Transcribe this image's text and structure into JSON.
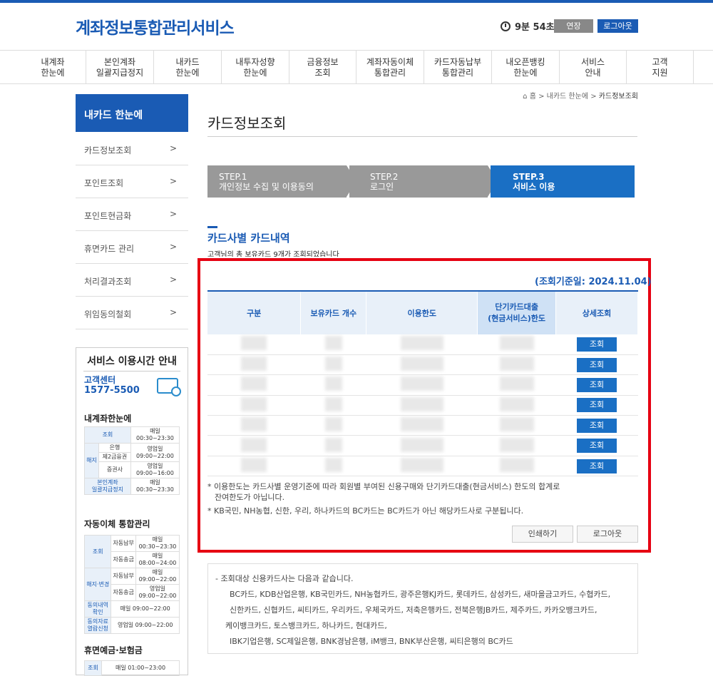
{
  "header": {
    "logo": "계좌정보통합관리서비스",
    "timer": "9분 54초",
    "extend_label": "연장",
    "logout_label": "로그아웃"
  },
  "gnb": [
    "내계좌\n한눈에",
    "본인계좌\n일괄지급정지",
    "내카드\n한눈에",
    "내투자성향\n한눈에",
    "금융정보\n조회",
    "계좌자동이체\n통합관리",
    "카드자동납부\n통합관리",
    "내오픈뱅킹\n한눈에",
    "서비스\n안내",
    "고객\n지원"
  ],
  "breadcrumb": [
    "홈",
    "내카드 한눈에",
    "카드정보조회"
  ],
  "sidebar": {
    "title": "내카드 한눈에",
    "items": [
      "카드정보조회",
      "포인트조회",
      "포인트현금화",
      "휴면카드 관리",
      "처리결과조회",
      "위임동의철회"
    ]
  },
  "timebox": {
    "title": "서비스 이용시간 안내",
    "cc_label": "고객센터",
    "cc_number": "1577-5500",
    "sec1": "내계좌한눈에",
    "sec2": "자동이체 통합관리",
    "sec3": "휴면예금·보험금",
    "t1": {
      "r1k": "조회",
      "r1v": "매일\n00:30~23:30",
      "g": "해지",
      "r2k": "은행",
      "r2v": "영업일\n09:00~22:00",
      "r3k": "제2금융권",
      "r4k": "증권사",
      "r4v": "영업일\n09:00~16:00",
      "r5k": "본인계좌\n일괄지급정지",
      "r5v": "매일\n00:30~23:30"
    },
    "t2": {
      "g1": "조회",
      "a": "자동납부",
      "av": "매일\n00:30~23:30",
      "b": "자동송금",
      "bv": "매일\n08:00~24:00",
      "g2": "해지·변경",
      "c": "자동납부",
      "cv": "매일\n09:00~22:00",
      "d": "자동송금",
      "dv": "영업일\n09:00~22:00",
      "e": "동의내역\n확인",
      "ev": "매일 09:00~22:00",
      "f": "동의자료\n열람신청",
      "fv": "영업일 09:00~22:00"
    },
    "t3": {
      "k": "조회",
      "v": "매일 01:00~23:00"
    }
  },
  "main": {
    "title": "카드정보조회",
    "steps": [
      {
        "num": "STEP.1",
        "label": "개인정보 수집 및 이용동의"
      },
      {
        "num": "STEP.2",
        "label": "로그인"
      },
      {
        "num": "STEP.3",
        "label": "서비스 이용"
      }
    ],
    "section_title": "카드사별 카드내역",
    "summary": "고객님의 총 보유카드 9개가 조회되었습니다",
    "as_of": "(조회기준일: 2024.11.04)",
    "table": {
      "headers": [
        "구분",
        "보유카드 개수",
        "이용한도",
        "단기카드대출\n(현금서비스)한도",
        "상세조회"
      ],
      "row_button": "조회",
      "rows": 7
    },
    "notes": [
      "* 이용한도는 카드사별 운영기준에 따라 회원별 부여된 신용구매와 단기카드대출(현금서비스) 한도의 합계로",
      "잔여한도가 아닙니다.",
      "* KB국민, NH농협, 신한, 우리, 하나카드의 BC카드는 BC카드가 아닌 해당카드사로 구분됩니다."
    ],
    "print_label": "인쇄하기",
    "logout_label": "로그아웃",
    "info": [
      "- 조회대상 신용카드사는 다음과 같습니다.",
      "BC카드, KDB산업은행, KB국민카드, NH농협카드, 광주은행KJ카드, 롯데카드, 삼성카드, 새마을금고카드, 수협카드,",
      "신한카드, 신협카드, 씨티카드, 우리카드, 우체국카드, 저축은행카드, 전북은행JB카드, 제주카드, 카카오뱅크카드,",
      "케이뱅크카드, 토스뱅크카드, 하나카드, 현대카드,",
      "IBK기업은행, SC제일은행, BNK경남은행, iM뱅크, BNK부산은행, 씨티은행의 BC카드"
    ]
  }
}
